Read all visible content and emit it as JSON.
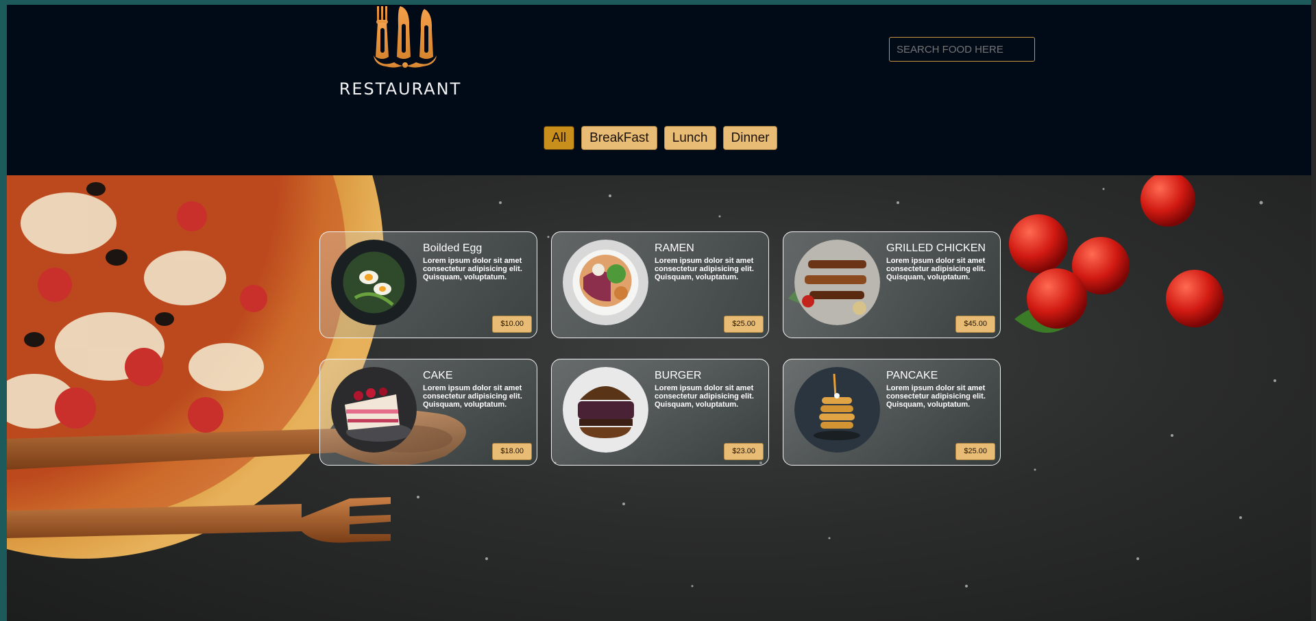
{
  "brand": {
    "name": "RESTAURANT",
    "logo_icon": "cutlery-logo-icon",
    "accent": "#e9a54a"
  },
  "search": {
    "placeholder": "SEARCH FOOD HERE"
  },
  "filters": [
    {
      "label": "All",
      "active": true
    },
    {
      "label": "BreakFast",
      "active": false
    },
    {
      "label": "Lunch",
      "active": false
    },
    {
      "label": "Dinner",
      "active": false
    }
  ],
  "menu": [
    {
      "title": "Boilded Egg",
      "desc": "Lorem ipsum dolor sit amet consectetur adipisicing elit. Quisquam, voluptatum.",
      "price": "$10.00"
    },
    {
      "title": "RAMEN",
      "desc": "Lorem ipsum dolor sit amet consectetur adipisicing elit. Quisquam, voluptatum.",
      "price": "$25.00"
    },
    {
      "title": "GRILLED CHICKEN",
      "desc": "Lorem ipsum dolor sit amet consectetur adipisicing elit. Quisquam, voluptatum.",
      "price": "$45.00"
    },
    {
      "title": "CAKE",
      "desc": "Lorem ipsum dolor sit amet consectetur adipisicing elit. Quisquam, voluptatum.",
      "price": "$18.00"
    },
    {
      "title": "BURGER",
      "desc": "Lorem ipsum dolor sit amet consectetur adipisicing elit. Quisquam, voluptatum.",
      "price": "$23.00"
    },
    {
      "title": "PANCAKE",
      "desc": "Lorem ipsum dolor sit amet consectetur adipisicing elit. Quisquam, voluptatum.",
      "price": "$25.00"
    }
  ],
  "colors": {
    "header_bg": "#010b18",
    "button_bg": "#e9bc75",
    "active_button_bg": "#c98f1c"
  }
}
